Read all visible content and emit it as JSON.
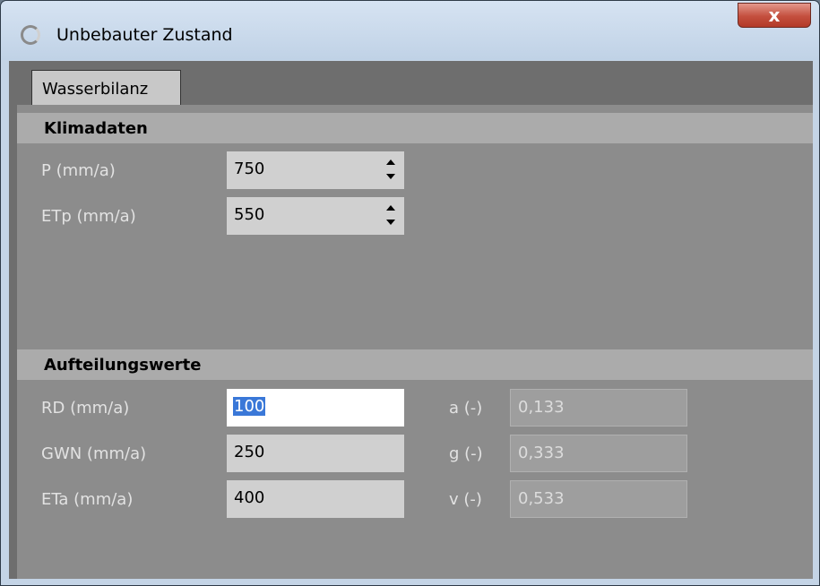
{
  "window": {
    "title": "Unbebauter Zustand",
    "close_glyph": "x"
  },
  "tabs": [
    {
      "label": "Wasserbilanz"
    }
  ],
  "klimadaten": {
    "header": "Klimadaten",
    "rows": [
      {
        "label": "P (mm/a)",
        "value": "750"
      },
      {
        "label": "ETp (mm/a)",
        "value": "550"
      }
    ]
  },
  "aufteilung": {
    "header": "Aufteilungswerte",
    "rows": [
      {
        "label": "RD (mm/a)",
        "value": "100",
        "ratio_label": "a (-)",
        "ratio_value": "0,133"
      },
      {
        "label": "GWN (mm/a)",
        "value": "250",
        "ratio_label": "g (-)",
        "ratio_value": "0,333"
      },
      {
        "label": "ETa (mm/a)",
        "value": "400",
        "ratio_label": "v (-)",
        "ratio_value": "0,533"
      }
    ]
  },
  "icons": {
    "app": "app-ring-icon",
    "close": "close-icon",
    "spin": "spinner-arrows-icon"
  }
}
